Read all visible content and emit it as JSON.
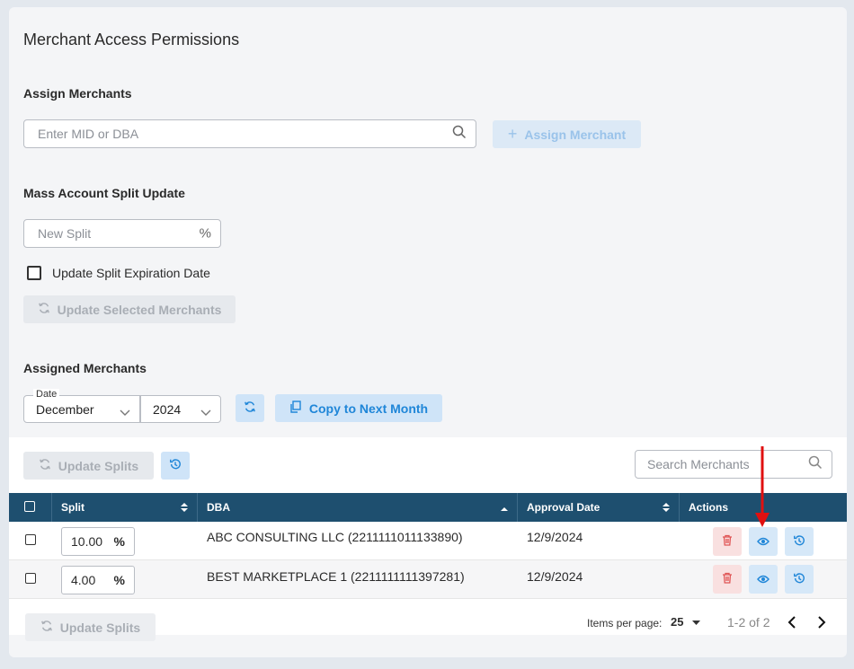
{
  "page_title": "Merchant Access Permissions",
  "assign": {
    "section_title": "Assign Merchants",
    "search_placeholder": "Enter MID or DBA",
    "assign_button": "Assign Merchant"
  },
  "mass_split": {
    "section_title": "Mass Account Split Update",
    "new_split_placeholder": "New Split",
    "percent_symbol": "%",
    "expiration_checkbox_label": "Update Split Expiration Date",
    "update_selected_button": "Update Selected Merchants"
  },
  "assigned": {
    "section_title": "Assigned Merchants",
    "date_label": "Date",
    "month_value": "December",
    "year_value": "2024",
    "copy_button": "Copy to Next Month"
  },
  "table_toolbar": {
    "update_splits_button": "Update Splits",
    "search_placeholder": "Search Merchants"
  },
  "table": {
    "columns": [
      "Split",
      "DBA",
      "Approval Date",
      "Actions"
    ],
    "rows": [
      {
        "split": "10.00",
        "dba": "ABC CONSULTING LLC (2211111011133890)",
        "approval_date": "12/9/2024"
      },
      {
        "split": "4.00",
        "dba": "BEST MARKETPLACE 1 (2211111111397281)",
        "approval_date": "12/9/2024"
      }
    ]
  },
  "pagination": {
    "items_per_page_label": "Items per page:",
    "items_per_page_value": "25",
    "range_text": "1-2 of 2"
  },
  "footer": {
    "update_splits_button": "Update Splits"
  },
  "colors": {
    "table_header": "#1e4f6f",
    "primary_blue": "#1f86d8",
    "annotation_arrow": "#e01010"
  }
}
